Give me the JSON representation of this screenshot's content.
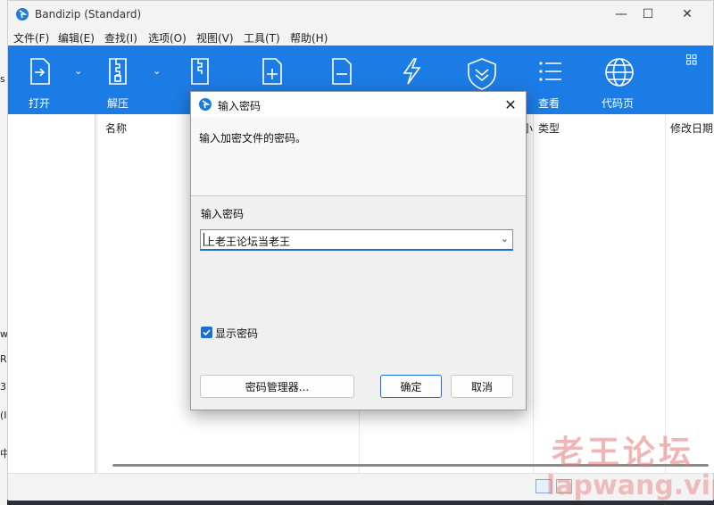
{
  "window": {
    "title": "Bandizip (Standard)",
    "controls": {
      "minimize": "—",
      "maximize": "☐",
      "close": "✕"
    }
  },
  "desktop_fragments": [
    "s",
    "w",
    "R",
    "3",
    "(I",
    "中"
  ],
  "menu": [
    {
      "label": "文件(F)"
    },
    {
      "label": "编辑(E)"
    },
    {
      "label": "查找(I)"
    },
    {
      "label": "选项(O)"
    },
    {
      "label": "视图(V)"
    },
    {
      "label": "工具(T)"
    },
    {
      "label": "帮助(H)"
    }
  ],
  "toolbar": {
    "open": {
      "label": "打开",
      "icon": "open-archive-icon"
    },
    "extract": {
      "label": "解压",
      "icon": "extract-icon"
    },
    "new_archive": {
      "icon": "new-archive-icon"
    },
    "add": {
      "icon": "add-file-icon"
    },
    "delete": {
      "icon": "delete-file-icon"
    },
    "test": {
      "icon": "lightning-icon"
    },
    "antivirus": {
      "icon": "shield-icon"
    },
    "view": {
      "label": "查看",
      "icon": "view-list-icon"
    },
    "codepage": {
      "label": "代码页",
      "icon": "globe-icon"
    },
    "dropdown_glyph": "⌄",
    "accent": "#1c7ce5"
  },
  "columns": {
    "name": "名称",
    "size_partial": "小",
    "type": "类型",
    "modified_partial": "修改日期"
  },
  "dialog": {
    "title": "输入密码",
    "description": "输入加密文件的密码。",
    "field_label": "输入密码",
    "password_value": "上老王论坛当老王",
    "dropdown_glyph": "⌄",
    "show_password_label": "显示密码",
    "show_password_checked": true,
    "manager_button": "密码管理器...",
    "ok_button": "确定",
    "cancel_button": "取消",
    "close_glyph": "✕"
  },
  "watermark": {
    "text": "老王论坛",
    "url": "lapwang.vip"
  }
}
